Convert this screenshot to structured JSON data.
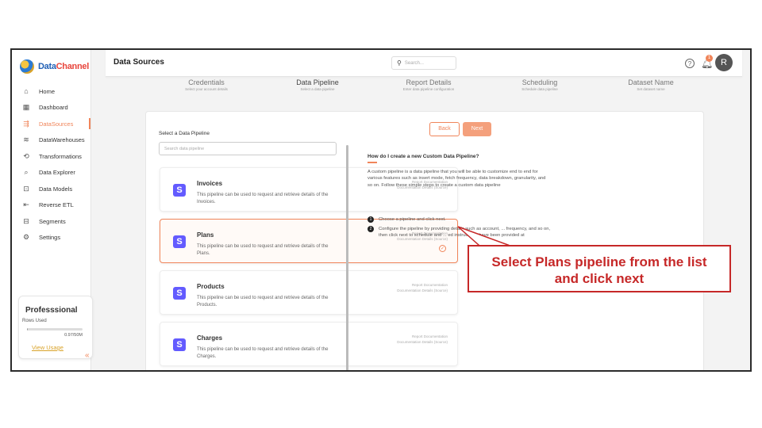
{
  "app": {
    "logo_part1": "Data",
    "logo_part2": "Channel"
  },
  "sidebar": {
    "items": [
      {
        "label": "Home",
        "icon": "home-icon",
        "glyph": "⌂"
      },
      {
        "label": "Dashboard",
        "icon": "dashboard-icon",
        "glyph": "▦"
      },
      {
        "label": "DataSources",
        "icon": "datasources-icon",
        "glyph": "⇶"
      },
      {
        "label": "DataWarehouses",
        "icon": "database-icon",
        "glyph": "≋"
      },
      {
        "label": "Transformations",
        "icon": "transform-icon",
        "glyph": "⟲"
      },
      {
        "label": "Data Explorer",
        "icon": "explorer-icon",
        "glyph": "⌕"
      },
      {
        "label": "Data Models",
        "icon": "models-icon",
        "glyph": "⊡"
      },
      {
        "label": "Reverse ETL",
        "icon": "reverse-etl-icon",
        "glyph": "⇤"
      },
      {
        "label": "Segments",
        "icon": "segments-icon",
        "glyph": "⊟"
      },
      {
        "label": "Settings",
        "icon": "gear-icon",
        "glyph": "⚙"
      }
    ],
    "active_index": 2,
    "plan": {
      "title": "Professsional",
      "rows_label": "Rows Used",
      "rows_amount": "0.97/50M",
      "rows_used_fraction": 0.02,
      "link": "View Usage"
    },
    "collapse_glyph": "«"
  },
  "header": {
    "title": "Data Sources",
    "search_placeholder": "Search...",
    "notification_count": "1",
    "avatar_initial": "R"
  },
  "steps": [
    {
      "title": "Credentials",
      "subtitle": "Select your account details"
    },
    {
      "title": "Data Pipeline",
      "subtitle": "Select a data pipeline"
    },
    {
      "title": "Report Details",
      "subtitle": "Enter data pipeline configuration"
    },
    {
      "title": "Scheduling",
      "subtitle": "Schedule data pipeline"
    },
    {
      "title": "Dataset Name",
      "subtitle": "Set dataset name"
    }
  ],
  "main": {
    "select_label": "Select a Data Pipeline",
    "search_placeholder": "Search data pipeline",
    "back_label": "Back",
    "next_label": "Next",
    "pipelines": [
      {
        "name": "Invoices",
        "desc": "This pipeline can be used to request and retrieve details of the Invoices.",
        "meta1": "Report Documentation",
        "meta2": "Documentation Details (Source)"
      },
      {
        "name": "Plans",
        "desc": "This pipeline can be used to request and retrieve details of the Plans.",
        "meta1": "Report Documentation",
        "meta2": "Documentation Details (Source)"
      },
      {
        "name": "Products",
        "desc": "This pipeline can be used to request and retrieve details of the Products.",
        "meta1": "Report Documentation",
        "meta2": "Documentation Details (Source)"
      },
      {
        "name": "Charges",
        "desc": "This pipeline can be used to request and retrieve details of the Charges.",
        "meta1": "Report Documentation",
        "meta2": "Documentation Details (Source)"
      }
    ],
    "selected_pipeline": "Plans",
    "help": {
      "title": "How do I create a new Custom Data Pipeline?",
      "body": "A custom pipeline is a data pipeline that you will be able to customize end to end for various features such as insert mode, fetch frequency, data breakdown, granularity, and so on. Follow these simple steps to create a custom data pipeline",
      "step1": "Choose a pipeline and click next.",
      "step2": "Configure the pipeline by providing details such as account, ... frequency, and so on, then click next to schedule and ... ed instructions have been provided at"
    }
  },
  "annotation": {
    "line1": "Select Plans pipeline from the list",
    "line2": "and click next"
  },
  "colors": {
    "accent": "#f0855a",
    "annotation_red": "#c62828",
    "stripe_purple": "#635bff"
  }
}
